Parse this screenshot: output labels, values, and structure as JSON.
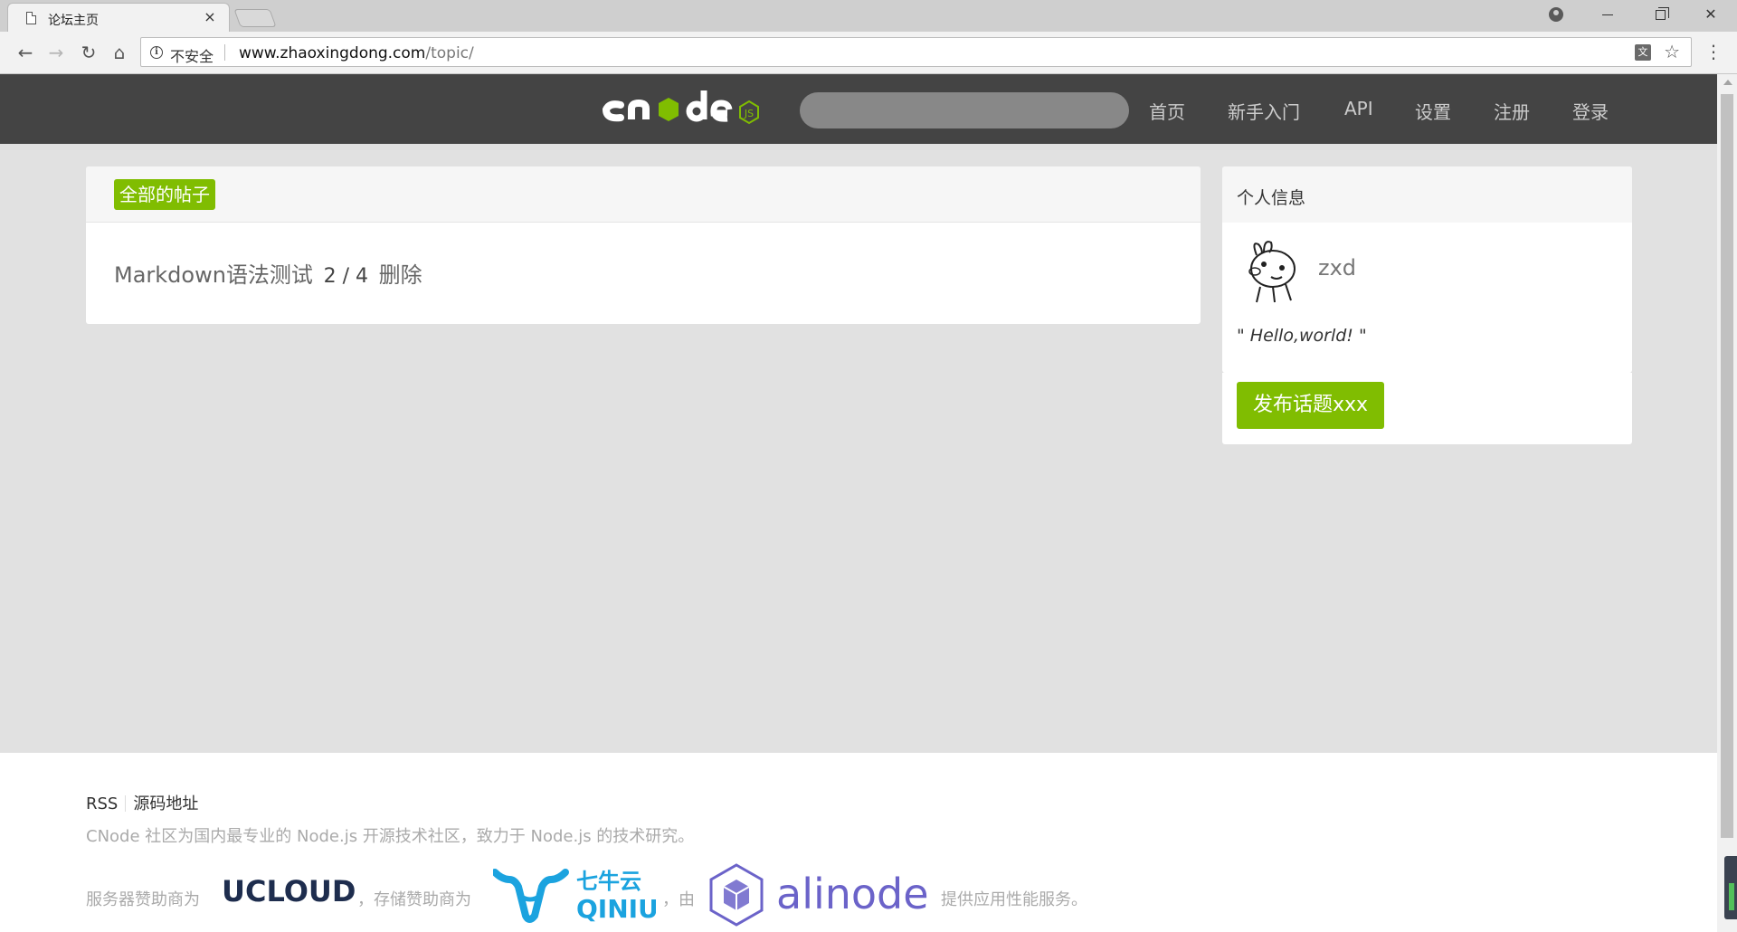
{
  "browser": {
    "tab_title": "论坛主页",
    "tab_close": "×",
    "security_label": "不安全",
    "url_host": "www.zhaoxingdong.com",
    "url_path": "/topic/"
  },
  "site": {
    "logo_alt": "cnode js",
    "search_placeholder": "",
    "nav": [
      "首页",
      "新手入门",
      "API",
      "设置",
      "注册",
      "登录"
    ]
  },
  "main": {
    "tab_label": "全部的帖子",
    "topics": [
      {
        "title": "Markdown语法测试",
        "replies": "2",
        "sep": "/",
        "views": "4",
        "delete_label": "删除"
      }
    ]
  },
  "sidebar": {
    "title": "个人信息",
    "username": "zxd",
    "signature": "\" Hello,world! \"",
    "publish_label": "发布话题xxx"
  },
  "footer": {
    "links": [
      "RSS",
      "源码地址"
    ],
    "description": "CNode 社区为国内最专业的 Node.js 开源技术社区，致力于 Node.js 的技术研究。",
    "sponsor_prefix": "服务器赞助商为",
    "ucloud": "UCLOUD",
    "storage_prefix": "，存储赞助商为",
    "qiniu_cn": "七牛云",
    "qiniu_en": "QINIU",
    "by_text": "，由",
    "alinode": "alinode",
    "suffix": "提供应用性能服务。"
  },
  "colors": {
    "header_bg": "#444444",
    "accent_green": "#80bd01",
    "page_bg": "#e1e1e1"
  }
}
